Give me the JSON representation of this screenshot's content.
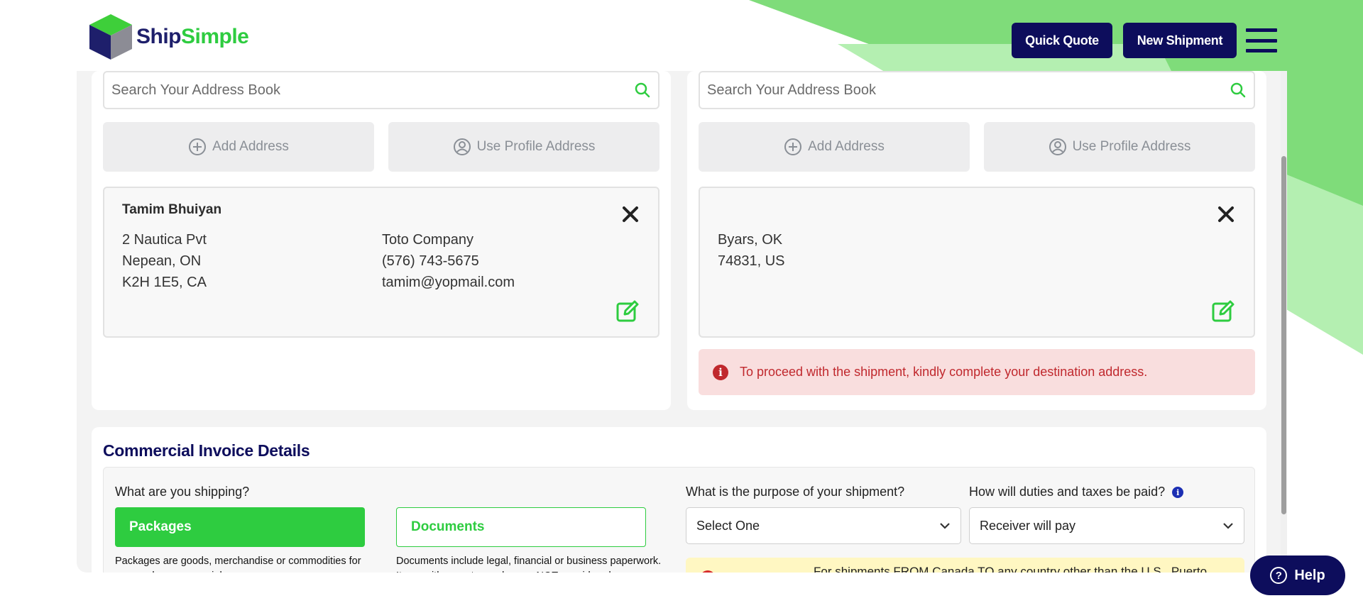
{
  "header": {
    "logo_ship": "Ship",
    "logo_simple": "Simple",
    "quick_quote": "Quick Quote",
    "new_shipment": "New Shipment"
  },
  "colors": {
    "brand_navy": "#0d0d5c",
    "brand_green": "#2ecc40",
    "error_red": "#c0282d",
    "warning_bg": "#fff7c2"
  },
  "origin": {
    "search_placeholder": "Search Your Address Book",
    "add_address": "Add Address",
    "use_profile_address": "Use Profile Address",
    "address": {
      "name": "Tamim Bhuiyan",
      "line1": "2 Nautica Pvt",
      "line2": "Nepean, ON",
      "line3": "K2H 1E5, CA",
      "company": "Toto Company",
      "phone": "(576) 743-5675",
      "email": "tamim@yopmail.com"
    }
  },
  "destination": {
    "search_placeholder": "Search Your Address Book",
    "add_address": "Add Address",
    "use_profile_address": "Use Profile Address",
    "address": {
      "line1": "Byars, OK",
      "line2": "74831, US"
    },
    "alert": "To proceed with the shipment, kindly complete your destination address."
  },
  "invoice": {
    "title": "Commercial Invoice Details",
    "what_shipping_label": "What are you shipping?",
    "packages_label": "Packages",
    "documents_label": "Documents",
    "packages_desc": "Packages are goods, merchandise or commodities for personal or commercial purposes.",
    "documents_desc": "Documents include legal, financial or business paperwork. Items with monetary value are NOT considered a",
    "purpose_label": "What is the purpose of your shipment?",
    "purpose_value": "Select One",
    "duties_label": "How will duties and taxes be paid?",
    "duties_value": "Receiver will pay",
    "warning_text": "For shipments FROM Canada TO any country other than the U.S., Puerto"
  },
  "help": {
    "label": "Help"
  }
}
